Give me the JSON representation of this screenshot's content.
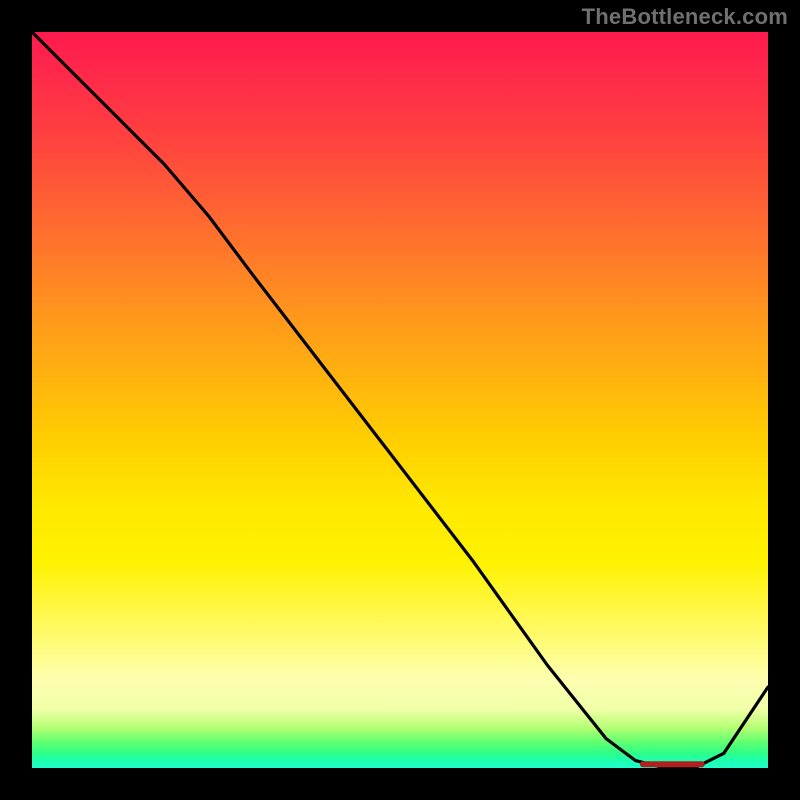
{
  "watermark": "TheBottleneck.com",
  "chart_data": {
    "type": "line",
    "title": "",
    "xlabel": "",
    "ylabel": "",
    "xlim": [
      0,
      100
    ],
    "ylim": [
      0,
      100
    ],
    "series": [
      {
        "name": "bottleneck-curve",
        "x": [
          0,
          6,
          12,
          18,
          24,
          30,
          40,
          50,
          60,
          70,
          78,
          82,
          86,
          90,
          94,
          100
        ],
        "values": [
          100,
          94,
          88,
          82,
          75,
          67,
          54,
          41,
          28,
          14,
          4,
          1,
          0,
          0,
          2,
          11
        ]
      }
    ],
    "flat_segment": {
      "x_start": 83,
      "x_end": 91,
      "y": 0.5
    },
    "gradient_note": "vertical rainbow red→green fills plot area"
  }
}
